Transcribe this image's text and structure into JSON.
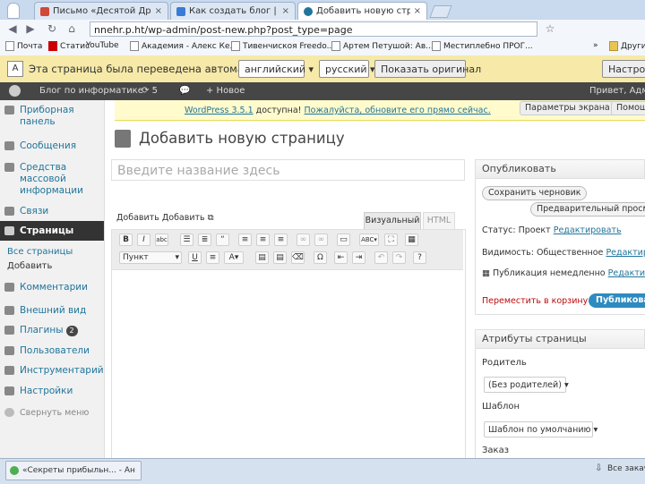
{
  "browser": {
    "tabs": [
      {
        "label": "Письмо «Десятой Друг...",
        "color": "#d14836"
      },
      {
        "label": "Как создать блог | Блог по...",
        "color": "#3a7bd5"
      },
      {
        "label": "Добавить новую страницу",
        "color": "#21759b"
      }
    ],
    "url": "nnehr.p.ht/wp-admin/post-new.php?post_type=page",
    "bookmarks": [
      "Почта",
      "Статис",
      "YouTube",
      "Академия - Алекс Ке...",
      "Тивенчискоя Freedo...",
      "Артем Петушой: Ав...",
      "Местиплебно ПРОГ...",
      "»",
      "Другие"
    ]
  },
  "translate": {
    "message": "Эта страница была переведена автоматически",
    "from_lang": "английский",
    "to_lang": "русский",
    "show_original": "Показать оригинал",
    "settings": "Настройки"
  },
  "adminbar": {
    "site": "Блог по информатике",
    "updates": "5",
    "new": "+ Новое",
    "greeting": "Привет, Адми"
  },
  "sidebar": {
    "items": [
      {
        "label": "Приборная панель"
      },
      {
        "label": "Сообщения"
      },
      {
        "label": "Средства массовой информации"
      },
      {
        "label": "Связи"
      },
      {
        "label": "Страницы"
      },
      {
        "label": "Комментарии"
      },
      {
        "label": "Внешний вид"
      },
      {
        "label": "Плагины",
        "badge": "2"
      },
      {
        "label": "Пользователи"
      },
      {
        "label": "Инструментарий"
      },
      {
        "label": "Настройки"
      },
      {
        "label": "Свернуть меню"
      }
    ],
    "sub_items": [
      "Все страницы",
      "Добавить"
    ]
  },
  "notice": {
    "version": "WordPress 3.5.1",
    "text_mid": "доступна!",
    "update_link": "Пожалуйста, обновите его прямо сейчас.",
    "screen_options": "Параметры экрана",
    "help": "Помощь"
  },
  "editor": {
    "heading": "Добавить новую страницу",
    "title_placeholder": "Введите название здесь",
    "upload_label": "Добавить Добавить",
    "tab_visual": "Визуальный",
    "tab_html": "HTML",
    "format_select": "Пункт"
  },
  "publish": {
    "title": "Опубликовать",
    "save_draft": "Сохранить черновик",
    "preview": "Предварительный просмо",
    "status_label": "Статус: Проект",
    "status_edit": "Редактировать",
    "visibility_label": "Видимость: Общественное",
    "visibility_edit": "Редактироват",
    "publish_label": "Публикация немедленно",
    "publish_edit": "Редактироват",
    "trash": "Переместить в корзину",
    "publish_btn": "Публиковать"
  },
  "attributes": {
    "title": "Атрибуты страницы",
    "parent_label": "Родитель",
    "parent_value": "(Без родителей)",
    "template_label": "Шаблон",
    "template_value": "Шаблон по умолчанию",
    "order_label": "Заказ"
  },
  "taskbar": {
    "window": "«Секреты прибыльн... - Ан",
    "all_tabs": "Все закачки"
  },
  "colors": {
    "accent": "#21759b",
    "adminbar": "#464646",
    "translate_bar": "#f7e9a8",
    "notice": "#fffbcc"
  }
}
